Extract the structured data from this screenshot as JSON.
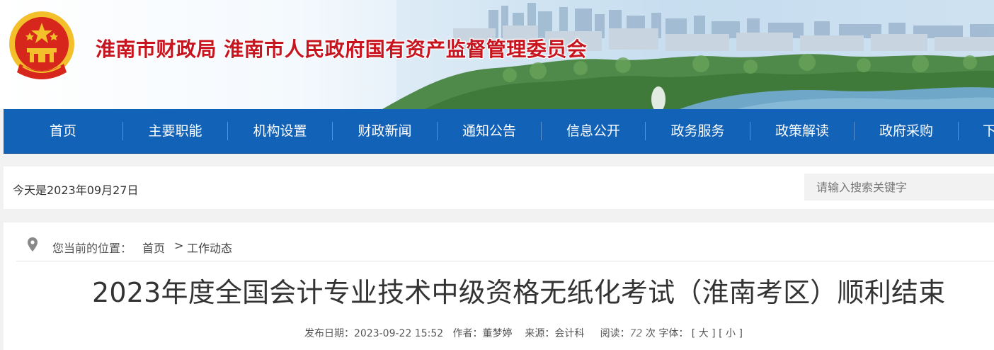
{
  "header": {
    "site_title": "淮南市财政局  淮南市人民政府国有资产监督管理委员会"
  },
  "nav": {
    "items": [
      {
        "label": "首页"
      },
      {
        "label": "主要职能"
      },
      {
        "label": "机构设置"
      },
      {
        "label": "财政新闻"
      },
      {
        "label": "通知公告"
      },
      {
        "label": "信息公开"
      },
      {
        "label": "政务服务"
      },
      {
        "label": "政策解读"
      },
      {
        "label": "政府采购"
      },
      {
        "label": "下"
      }
    ]
  },
  "datebar": {
    "today": "今天是2023年09月27日",
    "search_placeholder": "请输入搜索关键字"
  },
  "breadcrumb": {
    "label": "您当前的位置：",
    "home": "首页",
    "sep": ">",
    "current": "工作动态",
    "icon": "location-pin-icon"
  },
  "article": {
    "title": "2023年度全国会计专业技术中级资格无纸化考试（淮南考区）顺利结束",
    "publish_label": "发布日期：",
    "publish_date": "2023-09-22 15:52",
    "author_label": "作者：",
    "author": "董梦婷",
    "source_label": "来源：",
    "source": "会计科",
    "views_label": "阅读：",
    "views": "72",
    "views_unit": "次",
    "font_label": "字体：",
    "font_large": "[ 大 ]",
    "font_small": "[ 小 ]"
  },
  "colors": {
    "nav_bg": "#1262b7",
    "title_red": "#c8141e",
    "emblem_red": "#d7261c",
    "emblem_gold": "#f3c02c"
  }
}
